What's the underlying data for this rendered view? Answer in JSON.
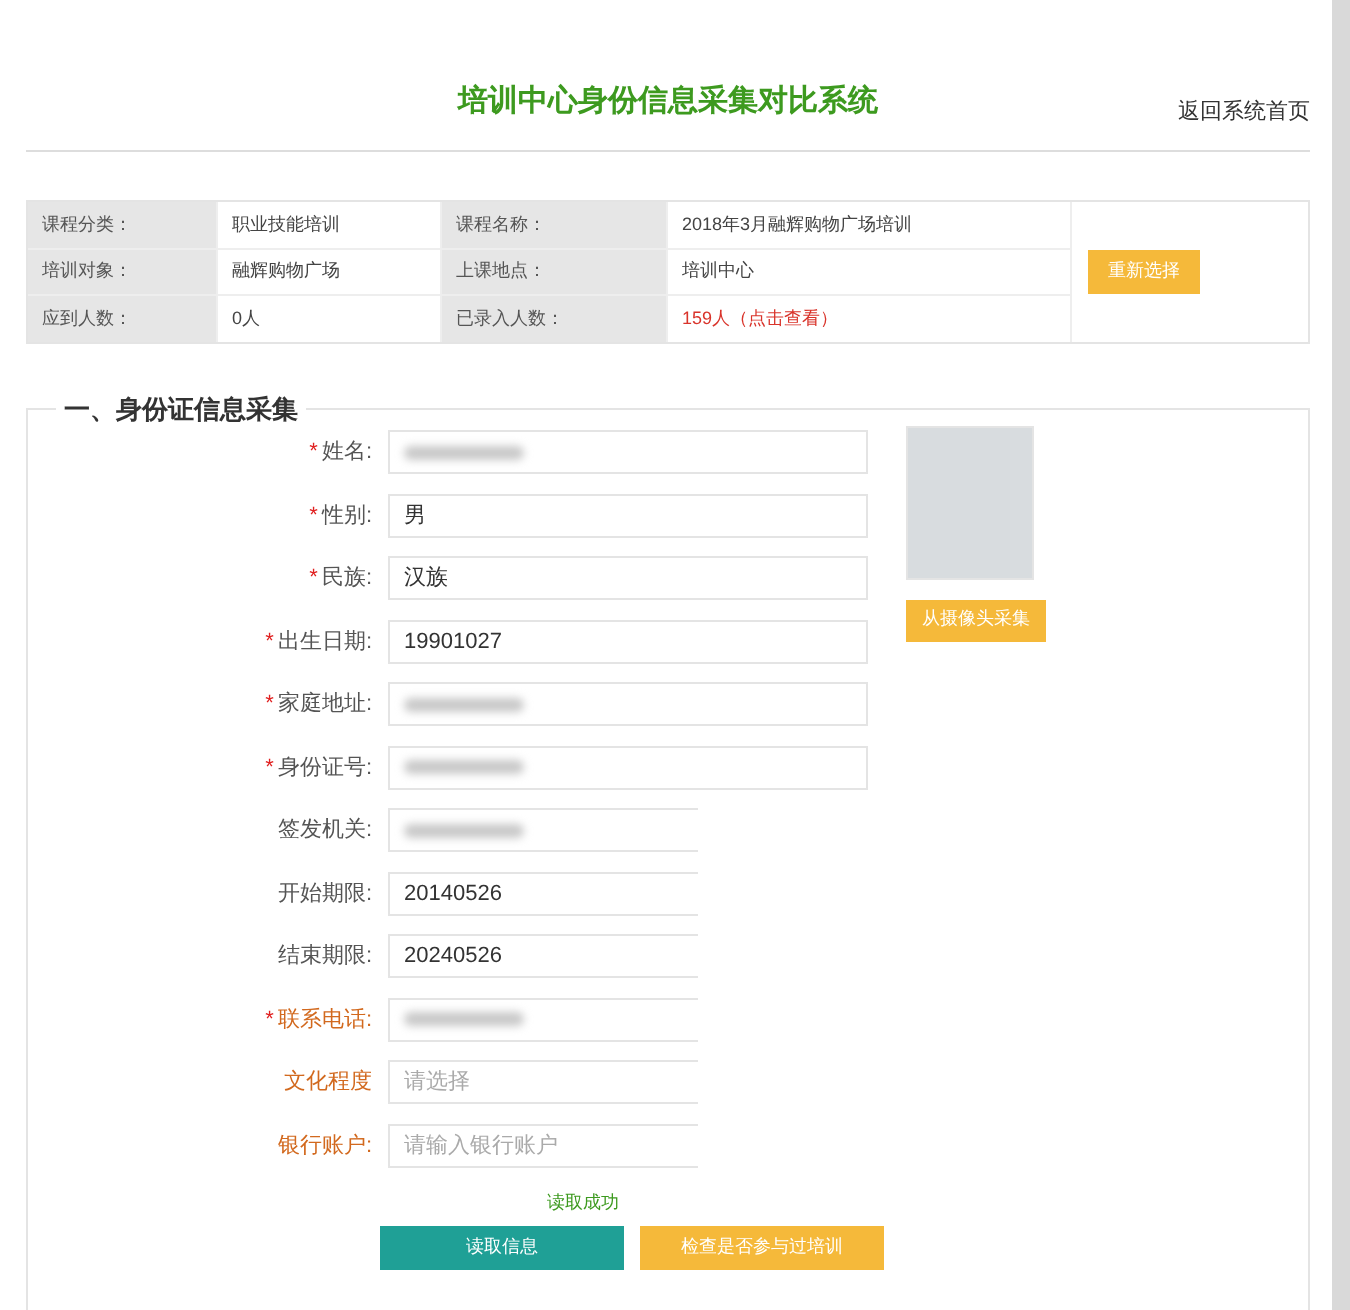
{
  "header": {
    "title": "培训中心身份信息采集对比系统",
    "back_link": "返回系统首页"
  },
  "course_table": {
    "rows": [
      {
        "cells": [
          {
            "kind": "label",
            "text": "课程分类："
          },
          {
            "kind": "value",
            "text": "职业技能培训"
          },
          {
            "kind": "label",
            "text": "课程名称："
          },
          {
            "kind": "value",
            "text": "2018年3月融辉购物广场培训"
          }
        ]
      },
      {
        "cells": [
          {
            "kind": "label",
            "text": "培训对象："
          },
          {
            "kind": "value",
            "text": "融辉购物广场"
          },
          {
            "kind": "label",
            "text": "上课地点："
          },
          {
            "kind": "value",
            "text": "培训中心"
          }
        ]
      },
      {
        "cells": [
          {
            "kind": "label",
            "text": "应到人数："
          },
          {
            "kind": "value",
            "text": "0人"
          },
          {
            "kind": "label",
            "text": "已录入人数："
          },
          {
            "kind": "link",
            "text": "159人（点击查看）"
          }
        ]
      }
    ],
    "reselect_button": "重新选择"
  },
  "id_section": {
    "title": "一、身份证信息采集",
    "required_mark": "*",
    "fields": [
      {
        "label": "姓名:",
        "required": true,
        "highlight": false,
        "redacted": true,
        "clipped": false
      },
      {
        "label": "性别:",
        "required": true,
        "highlight": false,
        "redacted": false,
        "value": "男",
        "clipped": false
      },
      {
        "label": "民族:",
        "required": true,
        "highlight": false,
        "redacted": false,
        "value": "汉族",
        "clipped": false
      },
      {
        "label": "出生日期:",
        "required": true,
        "highlight": false,
        "redacted": false,
        "value": "19901027",
        "clipped": false
      },
      {
        "label": "家庭地址:",
        "required": true,
        "highlight": false,
        "redacted": true,
        "clipped": false
      },
      {
        "label": "身份证号:",
        "required": true,
        "highlight": false,
        "redacted": true,
        "clipped": false
      },
      {
        "label": "签发机关:",
        "required": false,
        "highlight": false,
        "redacted": true,
        "clipped": true
      },
      {
        "label": "开始期限:",
        "required": false,
        "highlight": false,
        "redacted": false,
        "value": "20140526",
        "clipped": true
      },
      {
        "label": "结束期限:",
        "required": false,
        "highlight": false,
        "redacted": false,
        "value": "20240526",
        "clipped": true
      },
      {
        "label": "联系电话:",
        "required": true,
        "highlight": true,
        "redacted": true,
        "clipped": true
      },
      {
        "label": "文化程度",
        "required": false,
        "highlight": true,
        "redacted": false,
        "placeholder": "请选择",
        "clipped": true
      },
      {
        "label": "银行账户:",
        "required": false,
        "highlight": true,
        "redacted": false,
        "placeholder": "请输入银行账户",
        "clipped": true
      }
    ],
    "camera_button": "从摄像头采集",
    "status": "读取成功",
    "read_button": "读取信息",
    "check_button": "检查是否参与过培训"
  }
}
